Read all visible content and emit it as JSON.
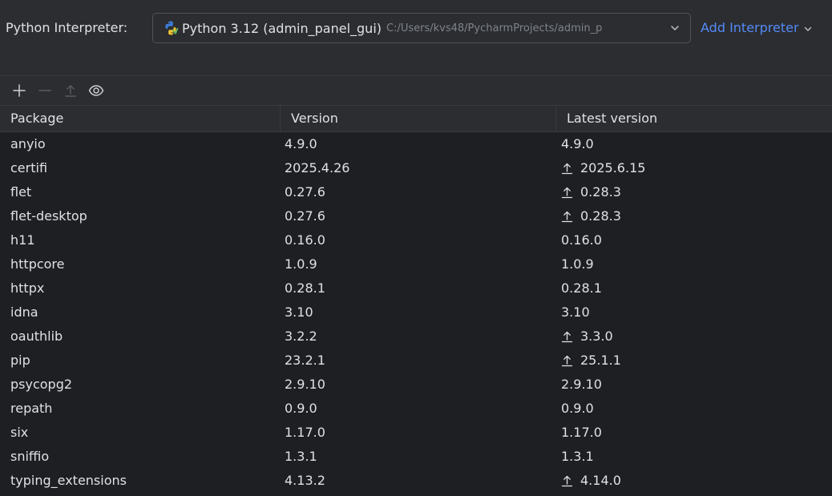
{
  "interpreter": {
    "label": "Python Interpreter:",
    "name": "Python 3.12 (admin_panel_gui)",
    "path": "C:/Users/kvs48/PycharmProjects/admin_p",
    "add_label": "Add Interpreter"
  },
  "toolbar": {
    "icons": [
      "plus-icon",
      "minus-icon",
      "upgrade-icon",
      "eye-icon"
    ]
  },
  "table": {
    "headers": [
      "Package",
      "Version",
      "Latest version"
    ],
    "rows": [
      {
        "package": "anyio",
        "version": "4.9.0",
        "latest": "4.9.0",
        "upgrade": false
      },
      {
        "package": "certifi",
        "version": "2025.4.26",
        "latest": "2025.6.15",
        "upgrade": true
      },
      {
        "package": "flet",
        "version": "0.27.6",
        "latest": "0.28.3",
        "upgrade": true
      },
      {
        "package": "flet-desktop",
        "version": "0.27.6",
        "latest": "0.28.3",
        "upgrade": true
      },
      {
        "package": "h11",
        "version": "0.16.0",
        "latest": "0.16.0",
        "upgrade": false
      },
      {
        "package": "httpcore",
        "version": "1.0.9",
        "latest": "1.0.9",
        "upgrade": false
      },
      {
        "package": "httpx",
        "version": "0.28.1",
        "latest": "0.28.1",
        "upgrade": false
      },
      {
        "package": "idna",
        "version": "3.10",
        "latest": "3.10",
        "upgrade": false
      },
      {
        "package": "oauthlib",
        "version": "3.2.2",
        "latest": "3.3.0",
        "upgrade": true
      },
      {
        "package": "pip",
        "version": "23.2.1",
        "latest": "25.1.1",
        "upgrade": true
      },
      {
        "package": "psycopg2",
        "version": "2.9.10",
        "latest": "2.9.10",
        "upgrade": false
      },
      {
        "package": "repath",
        "version": "0.9.0",
        "latest": "0.9.0",
        "upgrade": false
      },
      {
        "package": "six",
        "version": "1.17.0",
        "latest": "1.17.0",
        "upgrade": false
      },
      {
        "package": "sniffio",
        "version": "1.3.1",
        "latest": "1.3.1",
        "upgrade": false
      },
      {
        "package": "typing_extensions",
        "version": "4.13.2",
        "latest": "4.14.0",
        "upgrade": true
      }
    ]
  },
  "colors": {
    "background": "#2b2d30",
    "table_background": "#1e1f22",
    "link": "#548af7",
    "text": "#dfe1e5",
    "muted": "#7f838b"
  }
}
